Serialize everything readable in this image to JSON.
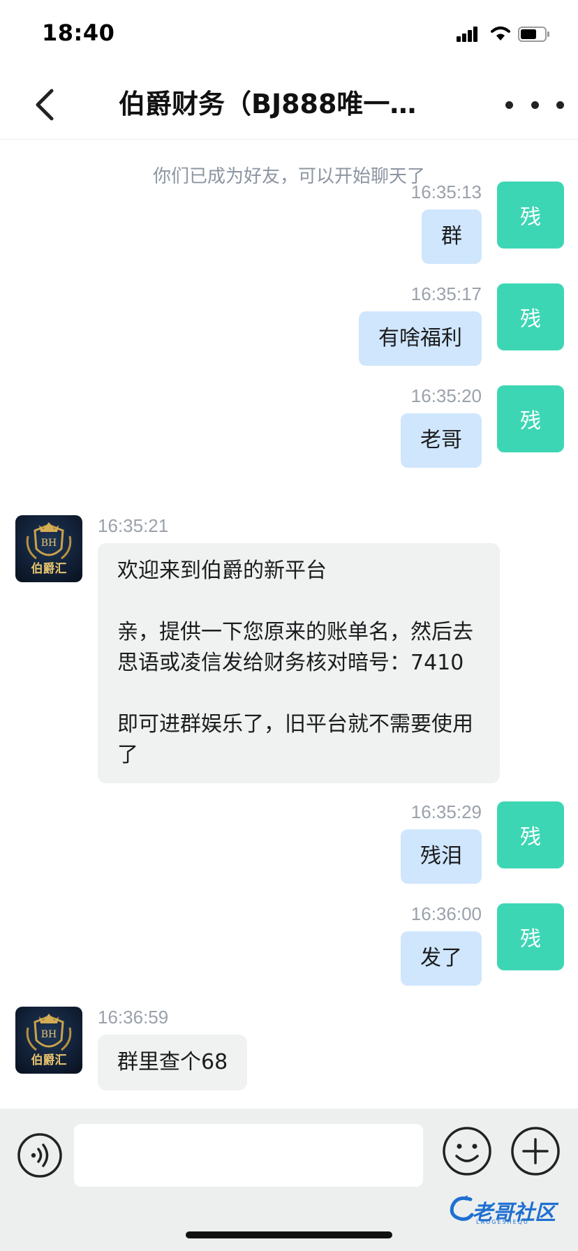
{
  "status_bar": {
    "time": "18:40"
  },
  "header": {
    "title": "伯爵财务（BJ888唯一…",
    "back_icon": "chevron-left-icon",
    "more_icon": "ellipsis-icon"
  },
  "system_notice": "你们已成为好友，可以开始聊天了",
  "messages": [
    {
      "direction": "out",
      "time": "16:35:13",
      "text": "群",
      "avatar": "残"
    },
    {
      "direction": "out",
      "time": "16:35:17",
      "text": "有啥福利",
      "avatar": "残"
    },
    {
      "direction": "out",
      "time": "16:35:20",
      "text": "老哥",
      "avatar": "残"
    },
    {
      "direction": "in",
      "time": "16:35:21",
      "paragraphs": [
        "欢迎来到伯爵的新平台",
        "亲，提供一下您原来的账单名，然后去思语或凌信发给财务核对暗号：7410",
        "即可进群娱乐了，旧平台就不需要使用了"
      ],
      "avatar_label": "伯爵汇",
      "avatar_monogram": "BH"
    },
    {
      "direction": "out",
      "time": "16:35:29",
      "text": "残泪",
      "avatar": "残"
    },
    {
      "direction": "out",
      "time": "16:36:00",
      "text": "发了",
      "avatar": "残"
    },
    {
      "direction": "in",
      "time": "16:36:59",
      "paragraphs": [
        "群里查个68"
      ],
      "avatar_label": "伯爵汇",
      "avatar_monogram": "BH"
    }
  ],
  "input_bar": {
    "placeholder": "",
    "voice_icon": "voice-icon",
    "emoji_icon": "emoji-icon",
    "plus_icon": "plus-icon"
  },
  "watermark": {
    "text": "老哥社区",
    "sub": "LAOGESHEQU"
  },
  "colors": {
    "self_avatar": "#3dd6b5",
    "outgoing_bubble": "#cfe6fd",
    "incoming_bubble": "#eff2f1",
    "input_bar_bg": "#ecefee"
  }
}
